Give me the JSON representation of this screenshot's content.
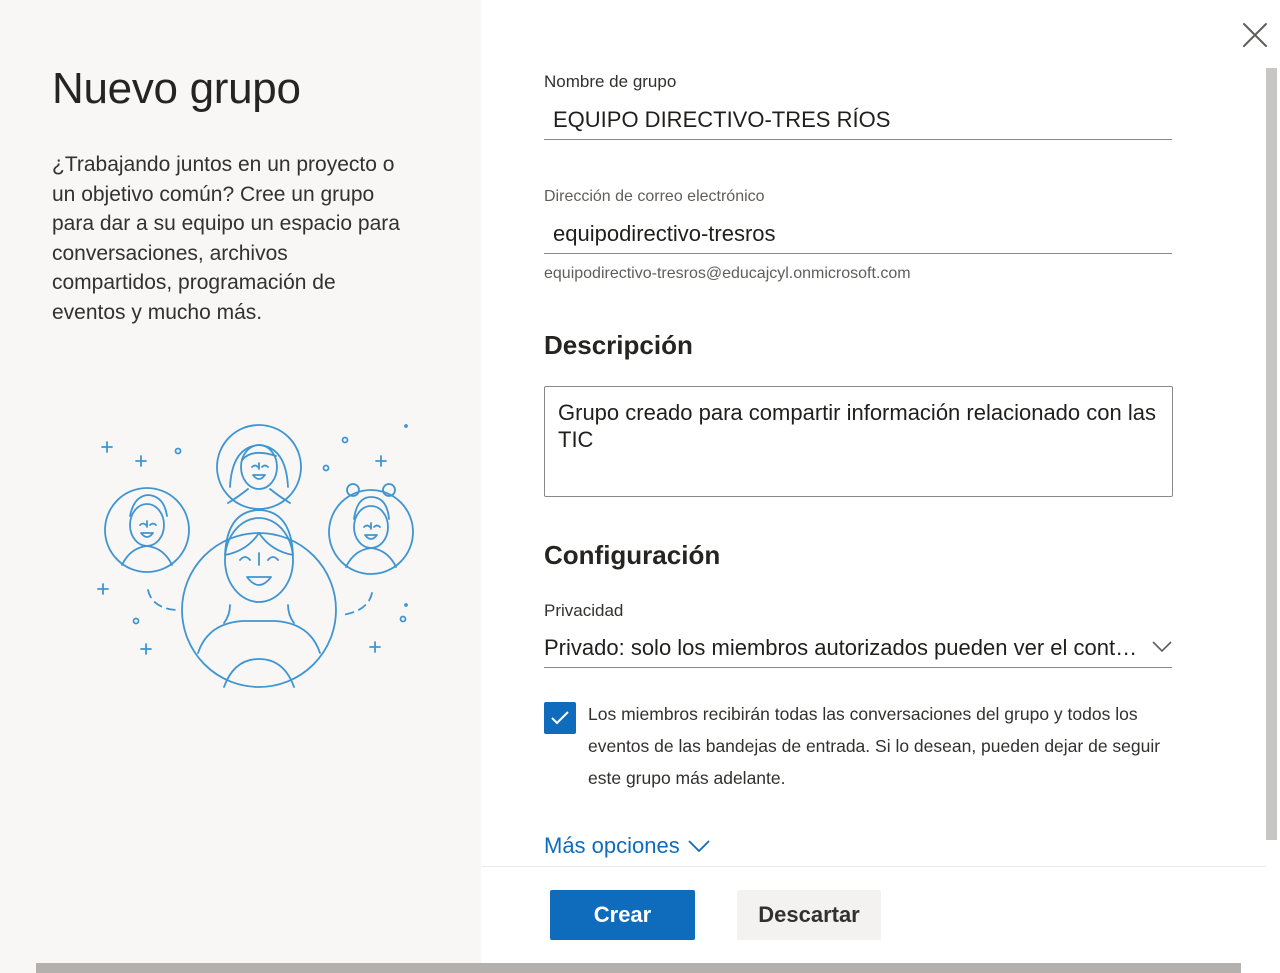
{
  "panel": {
    "title": "Nuevo grupo",
    "intro": "¿Trabajando juntos en un proyecto o un objetivo común? Cree un grupo para dar a su equipo un espacio para conversaciones, archivos compartidos, programación de eventos y mucho más."
  },
  "form": {
    "group_name_label": "Nombre de grupo",
    "group_name_value": "EQUIPO DIRECTIVO-TRES RÍOS",
    "email_label": "Dirección de correo electrónico",
    "email_value": "equipodirectivo-tresros",
    "email_full": "equipodirectivo-tresros@educajcyl.onmicrosoft.com",
    "description_heading": "Descripción",
    "description_value": "Grupo creado para compartir información relacionado con las TIC",
    "config_heading": "Configuración",
    "privacy_label": "Privacidad",
    "privacy_value": "Privado: solo los miembros autorizados pueden ver el contenido",
    "subscribe_checked": true,
    "subscribe_text": "Los miembros recibirán todas las conversaciones del grupo y todos los eventos de las bandejas de entrada. Si lo desean, pueden dejar de seguir este grupo más adelante.",
    "more_options": "Más opciones"
  },
  "buttons": {
    "create": "Crear",
    "discard": "Descartar"
  },
  "icons": {
    "close": "close-icon",
    "chevron": "chevron-down-icon",
    "check": "checkmark-icon"
  },
  "colors": {
    "accent": "#0f6cbd",
    "illustration": "#3f95d1",
    "left_panel": "#f8f7f6"
  }
}
